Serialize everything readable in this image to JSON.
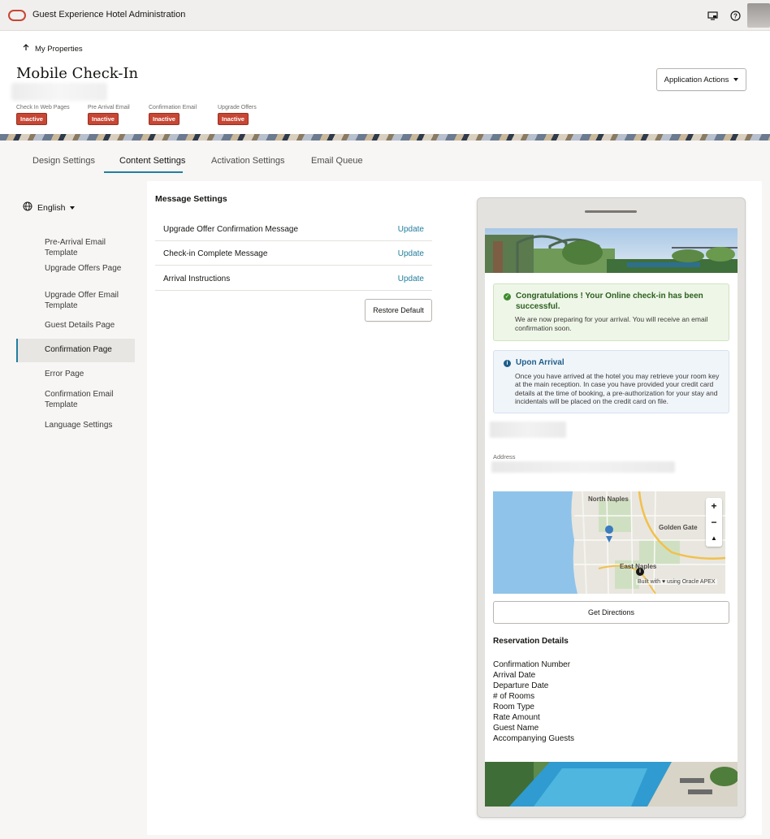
{
  "app": {
    "title": "Guest Experience Hotel Administration"
  },
  "header": {
    "back_label": "My Properties",
    "page_title": "Mobile Check-In",
    "actions_label": "Application Actions",
    "statuses": [
      {
        "label": "Check In Web Pages",
        "value": "Inactive"
      },
      {
        "label": "Pre Arrival Email",
        "value": "Inactive"
      },
      {
        "label": "Confirmation Email",
        "value": "Inactive"
      },
      {
        "label": "Upgrade Offers",
        "value": "Inactive"
      }
    ]
  },
  "tabs": [
    {
      "label": "Design Settings",
      "active": false
    },
    {
      "label": "Content Settings",
      "active": true
    },
    {
      "label": "Activation Settings",
      "active": false
    },
    {
      "label": "Email Queue",
      "active": false
    }
  ],
  "sidebar": {
    "language": "English",
    "items": [
      {
        "label": "Pre-Arrival Email Template"
      },
      {
        "label": "Upgrade Offers Page"
      },
      {
        "label": "Upgrade Offer Email Template"
      },
      {
        "label": "Guest Details Page"
      },
      {
        "label": "Confirmation Page",
        "active": true
      },
      {
        "label": "Error Page"
      },
      {
        "label": "Confirmation Email Template"
      },
      {
        "label": "Language Settings"
      }
    ]
  },
  "messages": {
    "title": "Message Settings",
    "update_label": "Update",
    "rows": [
      {
        "label": "Upgrade Offer Confirmation Message"
      },
      {
        "label": "Check-in Complete Message"
      },
      {
        "label": "Arrival Instructions"
      }
    ],
    "restore_label": "Restore Default"
  },
  "preview": {
    "success": {
      "title": "Congratulations ! Your Online check-in has been successful.",
      "body": "We are now preparing for your arrival. You will receive an email confirmation soon."
    },
    "info": {
      "title": "Upon Arrival",
      "body": "Once you have arrived at the hotel you may retrieve your room key at the main reception. In case you have provided your credit card details at the time of booking, a pre-authorization for your stay and incidentals will be placed on the credit card on file."
    },
    "address_label": "Address",
    "map": {
      "labels": [
        "North Naples",
        "Golden Gate",
        "East Naples"
      ],
      "zoom_in": "+",
      "zoom_out": "−",
      "attribution": "Built with ♥ using Oracle APEX"
    },
    "directions_label": "Get Directions",
    "reservation": {
      "title": "Reservation Details",
      "fields": [
        "Confirmation Number",
        "Arrival Date",
        "Departure Date",
        "# of Rooms",
        "Room Type",
        "Rate Amount",
        "Guest Name",
        "Accompanying Guests"
      ]
    }
  },
  "colors": {
    "accent": "#227e9e",
    "inactive": "#c74634",
    "oracle_red": "#c74634"
  }
}
